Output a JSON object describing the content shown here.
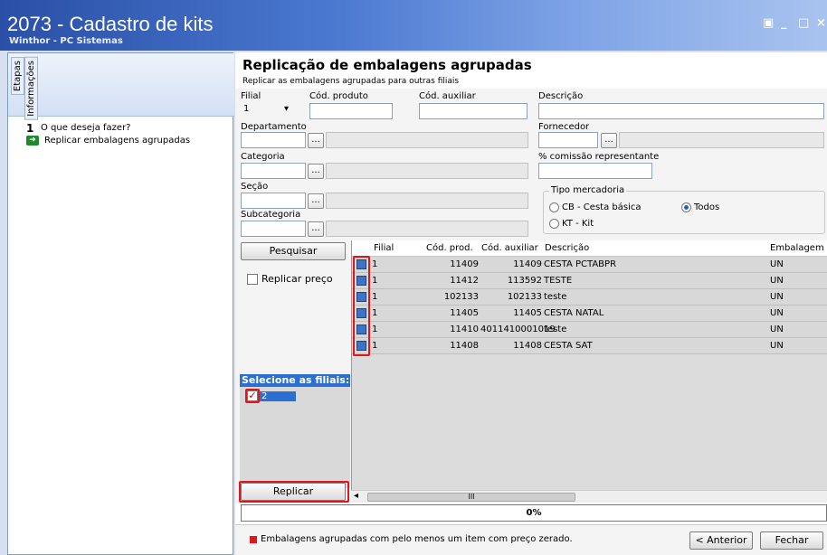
{
  "window": {
    "title": "2073 - Cadastro de kits",
    "subtitle": "Winthor - PC Sistemas",
    "controls": [
      "▣",
      "_",
      "□",
      "×"
    ]
  },
  "left": {
    "tabs": [
      "Etapas",
      "Informações"
    ],
    "steps": [
      {
        "num": "1",
        "label": "O que deseja fazer?"
      },
      {
        "num": "",
        "label": "Replicar embalagens agrupadas"
      }
    ]
  },
  "form": {
    "heading": "Replicação de embalagens agrupadas",
    "subheading": "Replicar as embalagens agrupadas para outras filiais",
    "filial_label": "Filial",
    "filial_value": "1",
    "cod_produto_label": "Cód. produto",
    "cod_auxiliar_label": "Cód. auxiliar",
    "descricao_label": "Descrição",
    "departamento_label": "Departamento",
    "fornecedor_label": "Fornecedor",
    "categoria_label": "Categoria",
    "comissao_label": "% comissão representante",
    "secao_label": "Seção",
    "subcategoria_label": "Subcategoria",
    "ellipsis": "...",
    "tipo_label": "Tipo mercadoria",
    "tipo_options": [
      "CB - Cesta básica",
      "Todos",
      "KT - Kit"
    ]
  },
  "actions": {
    "pesquisar": "Pesquisar",
    "replicar_preco": "Replicar preço",
    "replicar": "Replicar",
    "anterior": "< Anterior",
    "fechar": "Fechar"
  },
  "filiais": {
    "header": "Selecione as filiais:",
    "items": [
      "2"
    ]
  },
  "grid": {
    "columns": [
      "Filial",
      "Cód. prod.",
      "Cód. auxiliar",
      "Descrição",
      "Embalagem"
    ],
    "rows": [
      {
        "filial": "1",
        "cod_prod": "11409",
        "cod_aux": "11409",
        "descricao": "CESTA PCTABPR",
        "embalagem": "UN"
      },
      {
        "filial": "1",
        "cod_prod": "11412",
        "cod_aux": "113592",
        "descricao": "TESTE",
        "embalagem": "UN"
      },
      {
        "filial": "1",
        "cod_prod": "102133",
        "cod_aux": "102133",
        "descricao": "teste",
        "embalagem": "UN"
      },
      {
        "filial": "1",
        "cod_prod": "11405",
        "cod_aux": "11405",
        "descricao": "CESTA NATAL",
        "embalagem": "UN"
      },
      {
        "filial": "1",
        "cod_prod": "11410",
        "cod_aux": "4011410001019",
        "descricao": "teste",
        "embalagem": "UN"
      },
      {
        "filial": "1",
        "cod_prod": "11408",
        "cod_aux": "11408",
        "descricao": "CESTA SAT",
        "embalagem": "UN"
      }
    ],
    "scroll_label": "III"
  },
  "progress": {
    "text": "0%",
    "value": 0
  },
  "status": {
    "legend_text": "Embalagens agrupadas com pelo menos um item com preço zerado.",
    "legend_color": "#e0161c"
  },
  "colors": {
    "accent": "#2b6fd0",
    "highlight": "#e0161c",
    "row_icon": "#3d74c6"
  }
}
